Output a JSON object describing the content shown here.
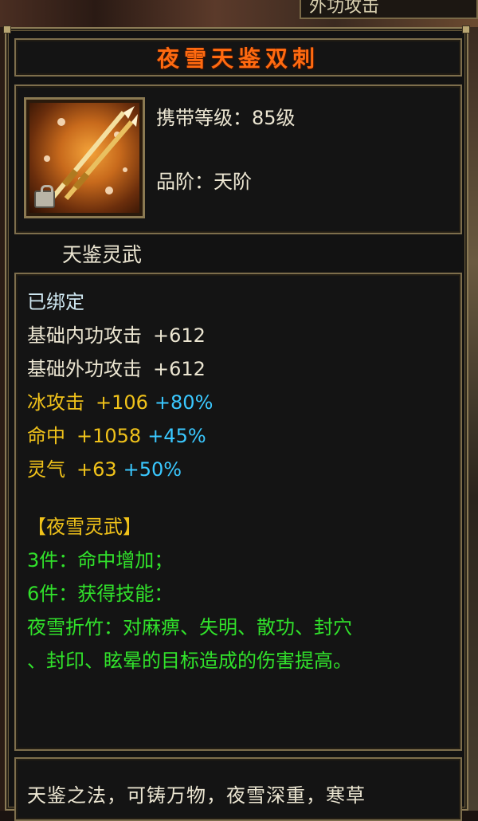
{
  "background": {
    "top_tab_text": "外功攻击"
  },
  "tooltip": {
    "title": "夜雪天鉴双刺",
    "item_icon": "twin-daggers-icon",
    "carry_level_label": "携带等级：",
    "carry_level_value": "85级",
    "grade_label": "品阶：",
    "grade_value": "天阶",
    "category": "天鉴灵武",
    "bound_status": "已绑定",
    "base_stats": [
      {
        "name": "基础内功攻击",
        "value": "+612"
      },
      {
        "name": "基础外功攻击",
        "value": "+612"
      }
    ],
    "bonus_stats": [
      {
        "name": "冰攻击",
        "value": "+106",
        "percent": "+80%"
      },
      {
        "name": "命中",
        "value": "+1058",
        "percent": "+45%"
      },
      {
        "name": "灵气",
        "value": "+63",
        "percent": "+50%"
      }
    ],
    "set": {
      "name": "【夜雪灵武】",
      "bonus_3": "3件：命中增加；",
      "bonus_6": "6件：获得技能：",
      "skill_line_1": "夜雪折竹：对麻痹、失明、散功、封穴",
      "skill_line_2": "、封印、眩晕的目标造成的伤害提高。"
    },
    "description": "天鉴之法，可铸万物，夜雪深重，寒草"
  },
  "colors": {
    "title": "#ff6a10",
    "bound": "#cfe8f2",
    "bonus_stat": "#f0c21a",
    "percent": "#3ac8ff",
    "set_text": "#31e22b",
    "border": "#7d6e4c"
  }
}
